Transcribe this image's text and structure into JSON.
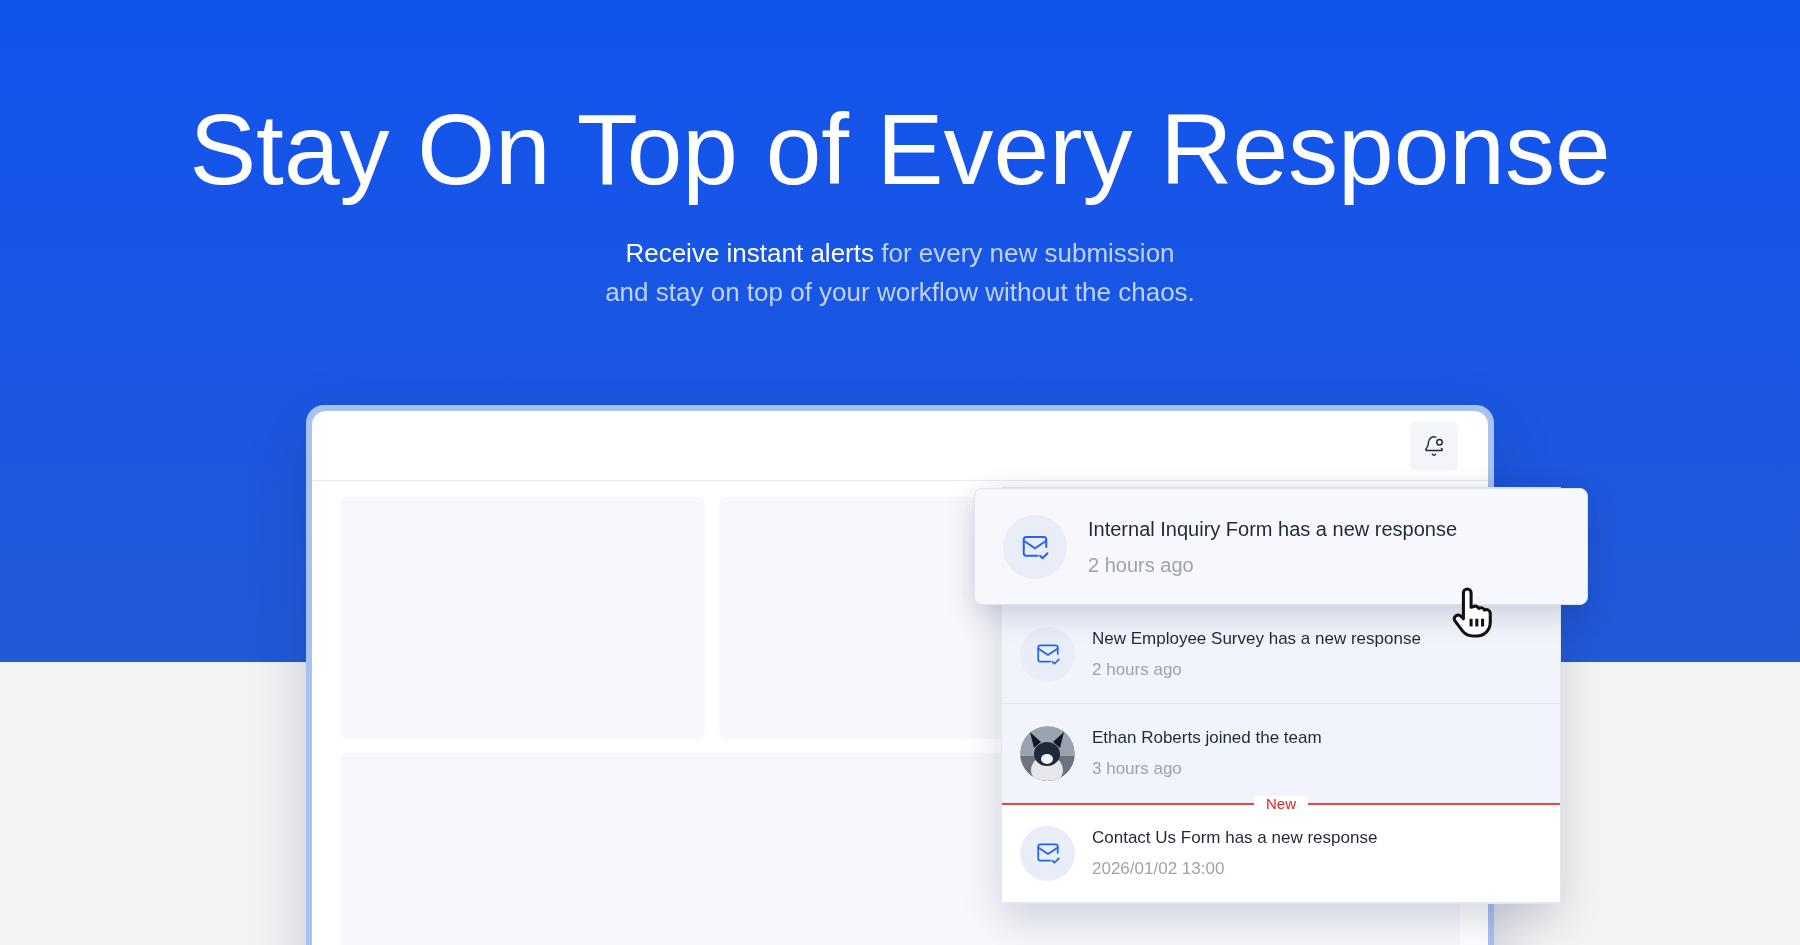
{
  "hero": {
    "title": "Stay On Top of Every Response",
    "subtitle_lines": [
      "**Receive instant alerts** for every new submission",
      "and stay on top of your workflow without the chaos."
    ]
  },
  "app_window": {
    "notifications": [
      {
        "kind": "form",
        "title": "Internal Inquiry Form has a new response",
        "time": "2 hours ago",
        "hovered": true,
        "read": true
      },
      {
        "kind": "form",
        "title": "New Employee Survey has a new response",
        "time": "2 hours ago",
        "hovered": false,
        "read": true
      },
      {
        "kind": "member",
        "title": "Ethan Roberts joined the team",
        "time": "3 hours ago",
        "hovered": false,
        "read": true
      },
      {
        "kind": "divider",
        "label": "New"
      },
      {
        "kind": "form",
        "title": "Contact Us Form has a new response",
        "time": "2026/01/02 13:00",
        "hovered": false,
        "read": false
      }
    ]
  }
}
